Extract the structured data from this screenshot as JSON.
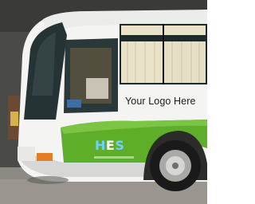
{
  "bus": {
    "logo_placeholder": "Your Logo Here",
    "brand_logo": {
      "text": "HES",
      "letters": [
        "H",
        "E",
        "S"
      ]
    },
    "colors": {
      "body": "#f4f5f3",
      "accent_stripe": "#5fae2a",
      "window": "#1d2a2c",
      "curtain": "#e9e1c8",
      "wheel": "#1a1a1a",
      "ground": "#8d8a84"
    }
  }
}
